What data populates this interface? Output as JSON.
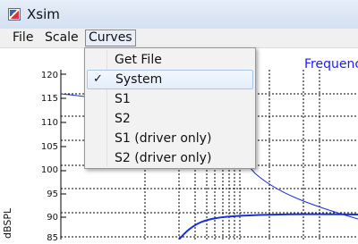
{
  "window": {
    "title": "Xsim"
  },
  "menubar": {
    "items": [
      "File",
      "Scale",
      "Curves"
    ]
  },
  "dropdown": {
    "items": [
      {
        "label": "Get File",
        "checked": false,
        "highlighted": false
      },
      {
        "label": "System",
        "checked": true,
        "highlighted": true
      },
      {
        "label": "S1",
        "checked": false,
        "highlighted": false
      },
      {
        "label": "S2",
        "checked": false,
        "highlighted": false
      },
      {
        "label": "S1 (driver only)",
        "checked": false,
        "highlighted": false
      },
      {
        "label": "S2 (driver only)",
        "checked": false,
        "highlighted": false
      }
    ],
    "check_glyph": "✓"
  },
  "plot": {
    "title_visible": "Frequenc",
    "ylabel": "dBSPL",
    "yticks": [
      "120",
      "115",
      "110",
      "105",
      "100",
      "95",
      "90",
      "85"
    ],
    "colors": {
      "curve": "#1a2fd6",
      "grid": "#000000"
    }
  }
}
